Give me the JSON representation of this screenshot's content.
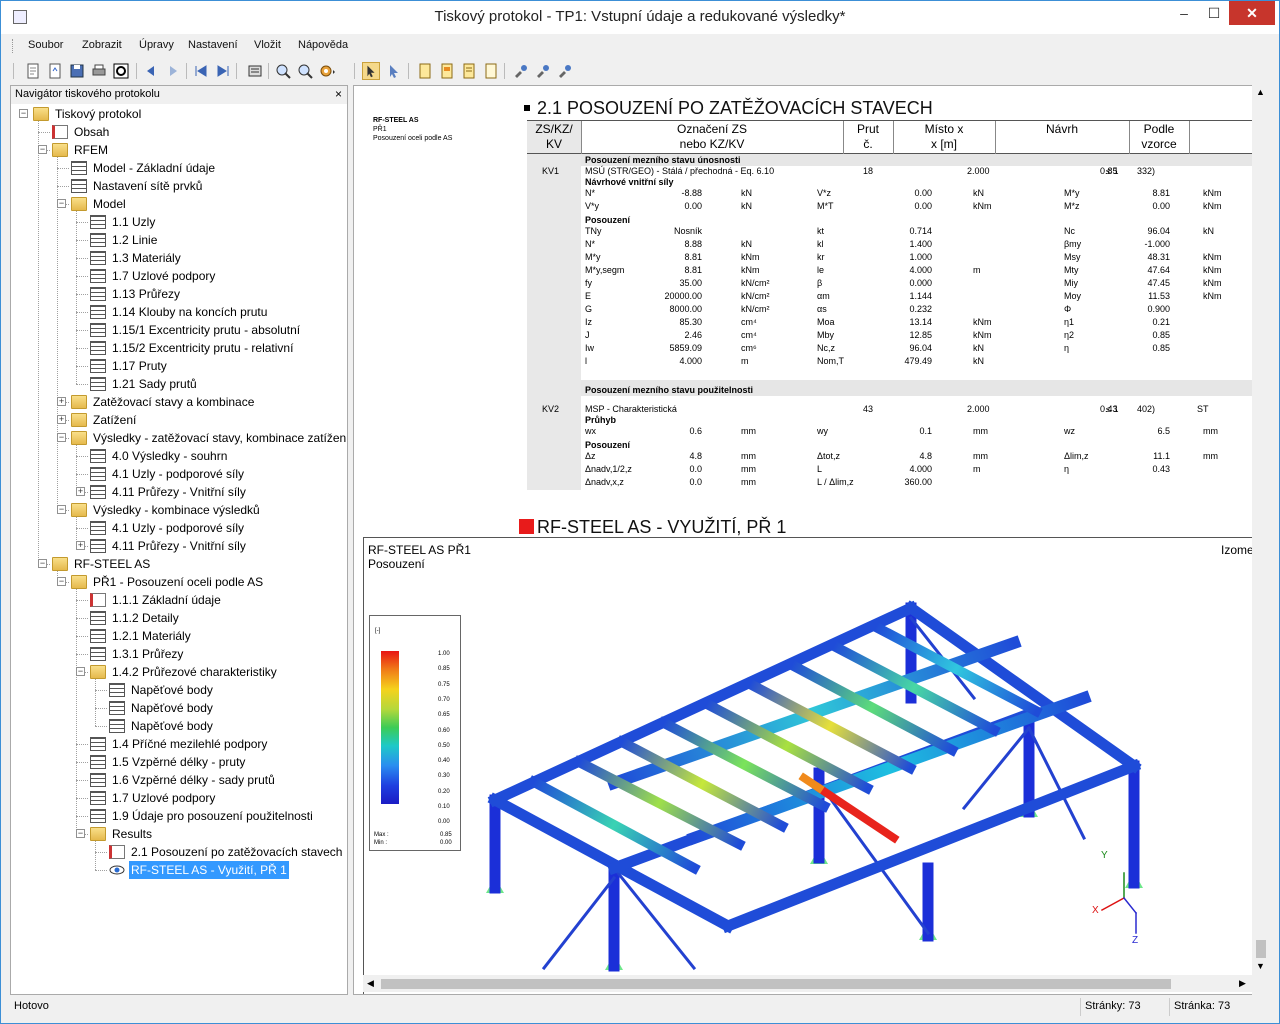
{
  "window": {
    "title": "Tiskový protokol - TP1: Vstupní údaje a redukované výsledky*",
    "minimize": "–",
    "maximize": "☐",
    "close": "✕"
  },
  "menu": [
    "Soubor",
    "Zobrazit",
    "Úpravy",
    "Nastavení",
    "Vložit",
    "Nápověda"
  ],
  "navigator": {
    "title": "Navigátor tiskového protokolu",
    "close": "×",
    "items": [
      {
        "label": "Tiskový protokol",
        "level": 0,
        "icon": "folder-icon",
        "exp": "−"
      },
      {
        "label": "Obsah",
        "level": 1,
        "icon": "document-icon"
      },
      {
        "label": "RFEM",
        "level": 1,
        "icon": "folder-icon",
        "exp": "−"
      },
      {
        "label": "Model - Základní údaje",
        "level": 2,
        "icon": "table-icon"
      },
      {
        "label": "Nastavení sítě prvků",
        "level": 2,
        "icon": "table-icon"
      },
      {
        "label": "Model",
        "level": 2,
        "icon": "folder-icon",
        "exp": "−"
      },
      {
        "label": "1.1 Uzly",
        "level": 3,
        "icon": "table-icon"
      },
      {
        "label": "1.2 Linie",
        "level": 3,
        "icon": "table-icon"
      },
      {
        "label": "1.3 Materiály",
        "level": 3,
        "icon": "table-icon"
      },
      {
        "label": "1.7 Uzlové podpory",
        "level": 3,
        "icon": "table-icon"
      },
      {
        "label": "1.13 Průřezy",
        "level": 3,
        "icon": "table-icon"
      },
      {
        "label": "1.14 Klouby na koncích prutu",
        "level": 3,
        "icon": "table-icon"
      },
      {
        "label": "1.15/1 Excentricity prutu - absolutní",
        "level": 3,
        "icon": "table-icon"
      },
      {
        "label": "1.15/2 Excentricity prutu - relativní",
        "level": 3,
        "icon": "table-icon"
      },
      {
        "label": "1.17 Pruty",
        "level": 3,
        "icon": "table-icon"
      },
      {
        "label": "1.21 Sady prutů",
        "level": 3,
        "icon": "table-icon"
      },
      {
        "label": "Zatěžovací stavy a kombinace",
        "level": 2,
        "icon": "folder-icon",
        "exp": "+"
      },
      {
        "label": "Zatížení",
        "level": 2,
        "icon": "folder-icon",
        "exp": "+"
      },
      {
        "label": "Výsledky - zatěžovací stavy, kombinace zatížení",
        "level": 2,
        "icon": "folder-icon",
        "exp": "−"
      },
      {
        "label": "4.0 Výsledky - souhrn",
        "level": 3,
        "icon": "table-icon"
      },
      {
        "label": "4.1 Uzly - podporové síly",
        "level": 3,
        "icon": "table-icon"
      },
      {
        "label": "4.11 Průřezy - Vnitřní síly",
        "level": 3,
        "icon": "table-icon",
        "exp": "+"
      },
      {
        "label": "Výsledky - kombinace výsledků",
        "level": 2,
        "icon": "folder-icon",
        "exp": "−"
      },
      {
        "label": "4.1 Uzly - podporové síly",
        "level": 3,
        "icon": "table-icon"
      },
      {
        "label": "4.11 Průřezy - Vnitřní síly",
        "level": 3,
        "icon": "table-icon",
        "exp": "+"
      },
      {
        "label": "RF-STEEL AS",
        "level": 1,
        "icon": "folder-icon",
        "exp": "−"
      },
      {
        "label": "PŘ1 - Posouzení oceli podle AS",
        "level": 2,
        "icon": "folder-icon",
        "exp": "−"
      },
      {
        "label": "1.1.1 Základní údaje",
        "level": 3,
        "icon": "document-icon"
      },
      {
        "label": "1.1.2 Detaily",
        "level": 3,
        "icon": "table-icon"
      },
      {
        "label": "1.2.1 Materiály",
        "level": 3,
        "icon": "table-icon"
      },
      {
        "label": "1.3.1 Průřezy",
        "level": 3,
        "icon": "table-icon"
      },
      {
        "label": "1.4.2 Průřezové charakteristiky",
        "level": 3,
        "icon": "folder-icon",
        "exp": "−"
      },
      {
        "label": "Napěťové body",
        "level": 4,
        "icon": "table-icon"
      },
      {
        "label": "Napěťové body",
        "level": 4,
        "icon": "table-icon"
      },
      {
        "label": "Napěťové body",
        "level": 4,
        "icon": "table-icon"
      },
      {
        "label": "1.4 Příčné mezilehlé podpory",
        "level": 3,
        "icon": "table-icon"
      },
      {
        "label": "1.5 Vzpěrné délky - pruty",
        "level": 3,
        "icon": "table-icon"
      },
      {
        "label": "1.6 Vzpěrné délky - sady prutů",
        "level": 3,
        "icon": "table-icon"
      },
      {
        "label": "1.7 Uzlové podpory",
        "level": 3,
        "icon": "table-icon"
      },
      {
        "label": "1.9 Údaje pro posouzení použitelnosti",
        "level": 3,
        "icon": "table-icon"
      },
      {
        "label": "Results",
        "level": 3,
        "icon": "folder-icon",
        "exp": "−"
      },
      {
        "label": "2.1 Posouzení po zatěžovacích stavech",
        "level": 4,
        "icon": "document-icon"
      },
      {
        "label": "RF-STEEL AS - Využití, PŘ 1",
        "level": 4,
        "icon": "eye-icon",
        "selected": true
      }
    ]
  },
  "doc": {
    "header_left": [
      "RF-STEEL AS",
      "PŘ1",
      "Posouzení oceli podle AS"
    ],
    "section1_title": "2.1 POSOUZENÍ PO ZATĚŽOVACÍCH STAVECH",
    "table_headers": [
      {
        "l1": "ZS/KZ/",
        "l2": "KV"
      },
      {
        "l1": "Označení ZS",
        "l2": "nebo KZ/KV"
      },
      {
        "l1": "Prut",
        "l2": "č."
      },
      {
        "l1": "Místo x",
        "l2": "x [m]"
      },
      {
        "l1": "",
        "l2": "Návrh"
      },
      {
        "l1": "Podle",
        "l2": "vzorce"
      }
    ],
    "kv1": {
      "band": "Posouzení mezního stavu únosnosti",
      "id": "KV1",
      "desc": "MSÚ (STR/GEO) - Stálá / přechodná - Eq. 6.10",
      "prut": "18",
      "x": "2.000",
      "navrh": "0.85",
      "cmp": "≤ 1",
      "vzorec": "332)",
      "forces_title": "Návrhové vnitřní síly",
      "check_title": "Posouzení"
    },
    "kv2": {
      "band": "Posouzení mezního stavu použitelnosti",
      "id": "KV2",
      "desc": "MSP - Charakteristická",
      "prut": "43",
      "x": "2.000",
      "navrh": "0.43",
      "cmp": "≤ 1",
      "vzorec": "402)",
      "extra": "ST",
      "defl_title": "Průhyb",
      "check_title": "Posouzení"
    },
    "kv1_rows": [
      [
        "N*",
        "-8.88",
        "kN",
        "V*z",
        "0.00",
        "kN",
        "M*y",
        "8.81",
        "kNm"
      ],
      [
        "V*y",
        "0.00",
        "kN",
        "M*T",
        "0.00",
        "kNm",
        "M*z",
        "0.00",
        "kNm"
      ]
    ],
    "kv1_check_rows": [
      [
        "TNy",
        "Nosník",
        "",
        "kt",
        "0.714",
        "",
        "Nc",
        "96.04",
        "kN"
      ],
      [
        "N*",
        "8.88",
        "kN",
        "kl",
        "1.400",
        "",
        "βmy",
        "-1.000",
        ""
      ],
      [
        "M*y",
        "8.81",
        "kNm",
        "kr",
        "1.000",
        "",
        "Msy",
        "48.31",
        "kNm"
      ],
      [
        "M*y,segm",
        "8.81",
        "kNm",
        "le",
        "4.000",
        "m",
        "Mty",
        "47.64",
        "kNm"
      ],
      [
        "fy",
        "35.00",
        "kN/cm²",
        "β",
        "0.000",
        "",
        "Miy",
        "47.45",
        "kNm"
      ],
      [
        "E",
        "20000.00",
        "kN/cm²",
        "αm",
        "1.144",
        "",
        "Moy",
        "11.53",
        "kNm"
      ],
      [
        "G",
        "8000.00",
        "kN/cm²",
        "αs",
        "0.232",
        "",
        "Φ",
        "0.900",
        ""
      ],
      [
        "Iz",
        "85.30",
        "cm⁴",
        "Moa",
        "13.14",
        "kNm",
        "η1",
        "0.21",
        ""
      ],
      [
        "J",
        "2.46",
        "cm⁴",
        "Mby",
        "12.85",
        "kNm",
        "η2",
        "0.85",
        ""
      ],
      [
        "Iw",
        "5859.09",
        "cm⁶",
        "Nc,z",
        "96.04",
        "kN",
        "η",
        "0.85",
        ""
      ],
      [
        "l",
        "4.000",
        "m",
        "Nom,T",
        "479.49",
        "kN",
        "",
        "",
        ""
      ]
    ],
    "kv2_rows": [
      [
        "wx",
        "0.6",
        "mm",
        "wy",
        "0.1",
        "mm",
        "wz",
        "6.5",
        "mm"
      ]
    ],
    "kv2_check_rows": [
      [
        "Δz",
        "4.8",
        "mm",
        "Δtot,z",
        "4.8",
        "mm",
        "Δlim,z",
        "11.1",
        "mm"
      ],
      [
        "Δnadv,1/2,z",
        "0.0",
        "mm",
        "L",
        "4.000",
        "m",
        "η",
        "0.43",
        ""
      ],
      [
        "Δnadv,x,z",
        "0.0",
        "mm",
        "L / Δlim,z",
        "360.00",
        "",
        "",
        "",
        ""
      ]
    ],
    "section2_title": "RF-STEEL AS - VYUŽITÍ, PŘ 1",
    "graph_title1": "RF-STEEL AS PŘ1",
    "graph_title2": "Posouzení",
    "graph_view": "Izome",
    "legend": {
      "unit": "[-]",
      "values": [
        "1.00",
        "0.85",
        "0.75",
        "0.70",
        "0.65",
        "0.60",
        "0.50",
        "0.40",
        "0.30",
        "0.20",
        "0.10",
        "0.00"
      ],
      "max_label": "Max :",
      "max": "0.85",
      "min_label": "Min :",
      "min": "0.00"
    },
    "axes": {
      "x": "X",
      "y": "Y",
      "z": "Z"
    }
  },
  "status": {
    "ready": "Hotovo",
    "pages": "Stránky: 73",
    "page": "Stránka: 73"
  }
}
